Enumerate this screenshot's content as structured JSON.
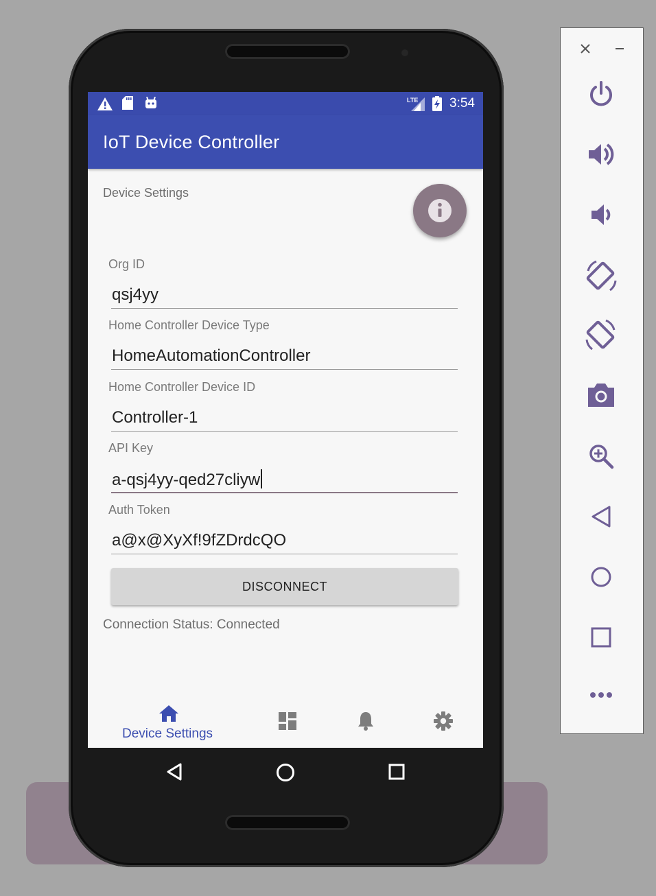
{
  "status_bar": {
    "time": "3:54",
    "icons": [
      "warning-icon",
      "sd-card-icon",
      "android-icon",
      "lte-signal-icon",
      "battery-charging-icon"
    ]
  },
  "app_bar": {
    "title": "IoT Device Controller"
  },
  "settings": {
    "section_title": "Device Settings",
    "fields": [
      {
        "label": "Org ID",
        "value": "qsj4yy"
      },
      {
        "label": "Home Controller Device Type",
        "value": "HomeAutomationController"
      },
      {
        "label": "Home Controller Device ID",
        "value": "Controller-1"
      },
      {
        "label": "API Key",
        "value": "a-qsj4yy-qed27cliyw"
      },
      {
        "label": "Auth Token",
        "value": "a@x@XyXf!9fZDrdcQO"
      }
    ],
    "disconnect_label": "DISCONNECT",
    "connection_status": "Connection Status: Connected"
  },
  "bottom_nav": {
    "items": [
      {
        "icon": "home-icon",
        "label": "Device Settings",
        "selected": true
      },
      {
        "icon": "dashboard-icon",
        "label": ""
      },
      {
        "icon": "bell-icon",
        "label": ""
      },
      {
        "icon": "gear-icon",
        "label": ""
      }
    ]
  },
  "system_nav": {
    "icons": [
      "back-icon",
      "home-circle-icon",
      "recents-icon"
    ]
  },
  "emulator_panel": {
    "buttons": [
      "close-icon",
      "minimize-icon",
      "power-icon",
      "volume-up-icon",
      "volume-down-icon",
      "rotate-left-icon",
      "rotate-right-icon",
      "camera-icon",
      "zoom-icon",
      "back-icon",
      "home-icon",
      "overview-icon",
      "more-icon"
    ]
  },
  "colors": {
    "primary": "#3c4eb0",
    "accent": "#8a7885",
    "background": "#f7f7f7",
    "panel_icon": "#6f5f96"
  }
}
